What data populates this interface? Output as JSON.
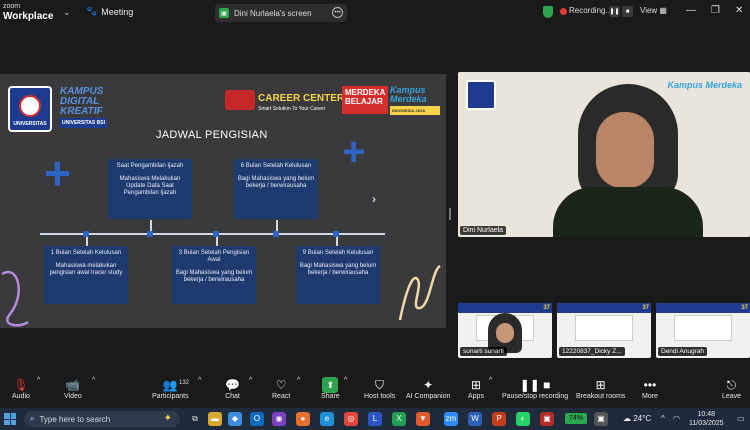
{
  "titlebar": {
    "logo_line1": "zoom",
    "logo_line2": "Workplace",
    "meeting_label": "Meeting",
    "screen_share_label": "Dini Nurlaela's screen",
    "recording_label": "Recording...",
    "view_label": "View"
  },
  "slide": {
    "uni_text": "UNIVERSITAS",
    "kdk_line1": "KAMPUS",
    "kdk_line2": "DIGITAL",
    "kdk_line3": "KREATIF",
    "kdk_sub": "UNIVERSITAS BSI",
    "career_title": "CAREER CENTER",
    "career_sub": "Smart Solution To Your Career",
    "mb_line1": "MERDEKA",
    "mb_line2": "BELAJAR",
    "km_line1": "Kampus",
    "km_line2": "Merdeka",
    "km_sub": "INDONESIA JAYA",
    "title": "JADWAL PENGISIAN",
    "boxes_top": [
      {
        "title": "Saat Pengambilan Ijazah",
        "body": "Mahasiswa Melakukan Update Data Saat Pengambilan Ijazah"
      },
      {
        "title": "6 Bulan Setelah Kelulusan",
        "body": "Bagi Mahasiswa yang belum bekerja / berwirausaha"
      }
    ],
    "boxes_bottom": [
      {
        "title": "1 Bulan Setelah Kelulusan",
        "body": "Mahasiswa melakukan pengisian awal tracer study"
      },
      {
        "title": "3 Bulan Setelah Pengisian Awal",
        "body": "Bagi Mahasiswa yang belum bekerja / berwirausaha"
      },
      {
        "title": "9 Bulan Setelah Kelulusan",
        "body": "Bagi Mahasiswa yang belum bekerja / berwirausaha"
      }
    ]
  },
  "speaker": {
    "name": "Dini Nurlaela",
    "bg_km": "Kampus Merdeka"
  },
  "thumbnails": [
    {
      "name": "sunarti sunarti",
      "number": "37"
    },
    {
      "name": "12220837_Dicky Z...",
      "number": "37"
    },
    {
      "name": "Dendi Anugrah",
      "number": "37"
    }
  ],
  "toolbar": {
    "audio": "Audio",
    "video": "Video",
    "participants": "Participants",
    "participants_count": "132",
    "chat": "Chat",
    "react": "React",
    "share": "Share",
    "host_tools": "Host tools",
    "ai_companion": "AI Companion",
    "apps": "Apps",
    "pause_recording": "Pause/stop recording",
    "breakout_rooms": "Breakout rooms",
    "more": "More",
    "leave": "Leave"
  },
  "taskbar": {
    "search_placeholder": "Type here to search",
    "battery": "74%",
    "weather": "24°C",
    "time": "10:48",
    "date": "11/03/2025"
  },
  "colors": {
    "accent_green": "#2da44e",
    "record_red": "#e53935",
    "slide_bg": "#3a3a3c",
    "box_blue": "#1e3a6e"
  }
}
